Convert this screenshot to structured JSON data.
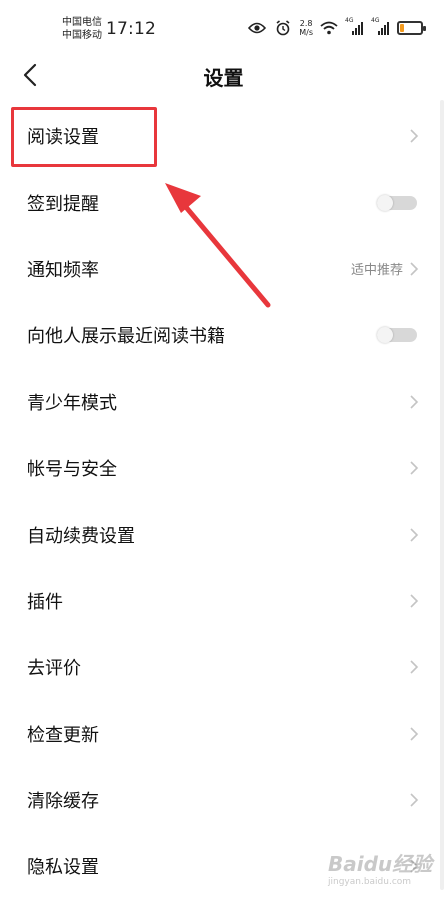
{
  "status_bar": {
    "carrier_1": "中国电信",
    "carrier_2": "中国移动",
    "time": "17:12",
    "speed_value": "2.8",
    "speed_unit": "M/s",
    "signal_label_1": "4G",
    "signal_label_2": "4G",
    "icons": [
      "eye-icon",
      "alarm-icon",
      "wifi-icon",
      "signal-icon",
      "signal-icon",
      "battery-icon"
    ],
    "battery_level": 0.2,
    "battery_color": "#f39a1e"
  },
  "header": {
    "title": "设置",
    "back_icon": "chevron-left-icon"
  },
  "settings": {
    "items": [
      {
        "label": "阅读设置",
        "control": "chevron"
      },
      {
        "label": "签到提醒",
        "control": "toggle",
        "on": false
      },
      {
        "label": "通知频率",
        "control": "chevron",
        "value": "适中推荐"
      },
      {
        "label": "向他人展示最近阅读书籍",
        "control": "toggle",
        "on": false
      },
      {
        "label": "青少年模式",
        "control": "chevron"
      },
      {
        "label": "帐号与安全",
        "control": "chevron"
      },
      {
        "label": "自动续费设置",
        "control": "chevron"
      },
      {
        "label": "插件",
        "control": "chevron"
      },
      {
        "label": "去评价",
        "control": "chevron"
      },
      {
        "label": "检查更新",
        "control": "chevron"
      },
      {
        "label": "清除缓存",
        "control": "chevron"
      },
      {
        "label": "隐私设置",
        "control": "chevron"
      }
    ]
  },
  "annotation": {
    "highlight_color": "#e8373c",
    "arrow_color": "#e8373c"
  },
  "watermark": {
    "brand": "Baidu经验",
    "url": "jingyan.baidu.com"
  }
}
